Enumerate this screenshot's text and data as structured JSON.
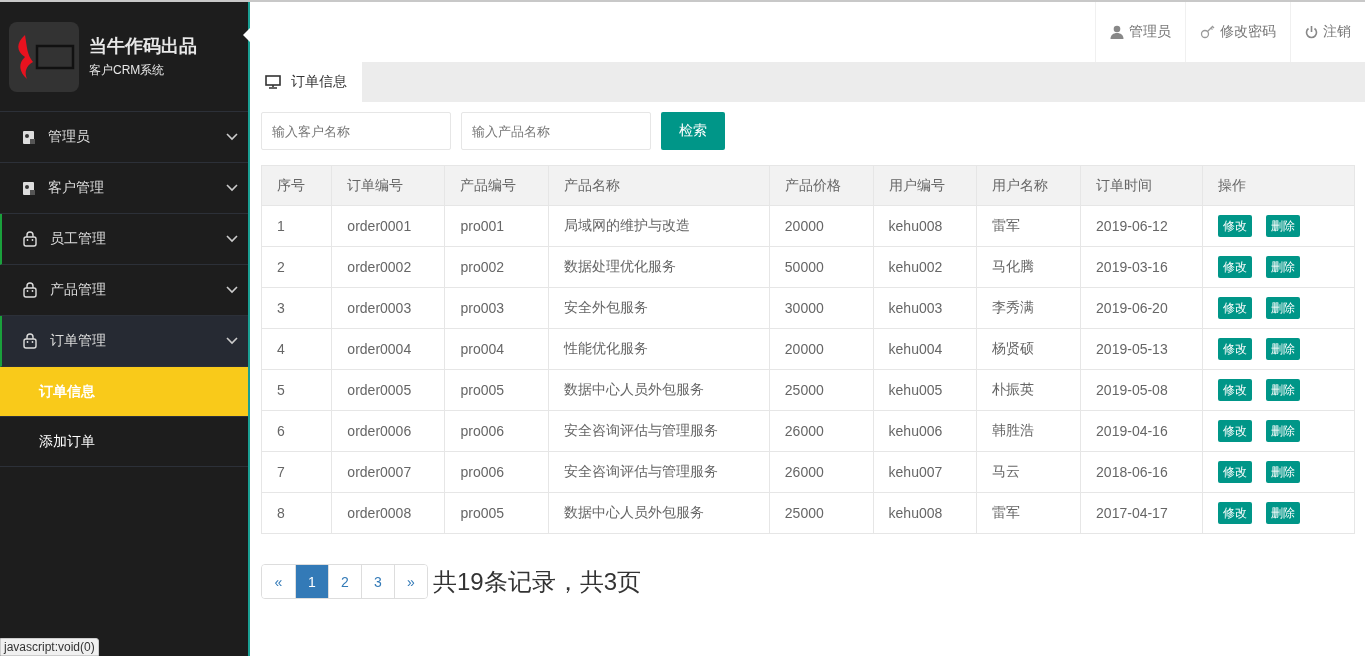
{
  "brand": {
    "title": "当牛作码出品",
    "subtitle": "客户CRM系统"
  },
  "sidebar": {
    "items": [
      {
        "label": "管理员",
        "kind": "badge",
        "expanded": false,
        "marked": false
      },
      {
        "label": "客户管理",
        "kind": "badge",
        "expanded": false,
        "marked": false
      },
      {
        "label": "员工管理",
        "kind": "bag",
        "expanded": false,
        "marked": true
      },
      {
        "label": "产品管理",
        "kind": "bag",
        "expanded": false,
        "marked": false
      },
      {
        "label": "订单管理",
        "kind": "bag",
        "expanded": true,
        "marked": true,
        "children": [
          {
            "label": "订单信息",
            "selected": true
          },
          {
            "label": "添加订单",
            "selected": false
          }
        ]
      }
    ]
  },
  "header": {
    "links": [
      {
        "kind": "user",
        "label": "管理员"
      },
      {
        "kind": "key",
        "label": "修改密码"
      },
      {
        "kind": "power",
        "label": "注销"
      }
    ]
  },
  "tabs": [
    {
      "label": "订单信息",
      "selected": true
    }
  ],
  "search": {
    "fields": [
      {
        "placeholder": "输入客户名称"
      },
      {
        "placeholder": "输入产品名称"
      }
    ],
    "button": "检索"
  },
  "table": {
    "columns": [
      "序号",
      "订单编号",
      "产品编号",
      "产品名称",
      "产品价格",
      "用户编号",
      "用户名称",
      "订单时间",
      "操作"
    ],
    "rows": [
      {
        "cells": [
          "1",
          "order0001",
          "pro001",
          "局域网的维护与改造",
          "20000",
          "kehu008",
          "雷军",
          "2019-06-12"
        ],
        "actions": [
          "修改",
          "删除"
        ]
      },
      {
        "cells": [
          "2",
          "order0002",
          "pro002",
          "数据处理优化服务",
          "50000",
          "kehu002",
          "马化腾",
          "2019-03-16"
        ],
        "actions": [
          "修改",
          "删除"
        ]
      },
      {
        "cells": [
          "3",
          "order0003",
          "pro003",
          "安全外包服务",
          "30000",
          "kehu003",
          "李秀满",
          "2019-06-20"
        ],
        "actions": [
          "修改",
          "删除"
        ]
      },
      {
        "cells": [
          "4",
          "order0004",
          "pro004",
          "性能优化服务",
          "20000",
          "kehu004",
          "杨贤硕",
          "2019-05-13"
        ],
        "actions": [
          "修改",
          "删除"
        ]
      },
      {
        "cells": [
          "5",
          "order0005",
          "pro005",
          "数据中心人员外包服务",
          "25000",
          "kehu005",
          "朴振英",
          "2019-05-08"
        ],
        "actions": [
          "修改",
          "删除"
        ]
      },
      {
        "cells": [
          "6",
          "order0006",
          "pro006",
          "安全咨询评估与管理服务",
          "26000",
          "kehu006",
          "韩胜浩",
          "2019-04-16"
        ],
        "actions": [
          "修改",
          "删除"
        ]
      },
      {
        "cells": [
          "7",
          "order0007",
          "pro006",
          "安全咨询评估与管理服务",
          "26000",
          "kehu007",
          "马云",
          "2018-06-16"
        ],
        "actions": [
          "修改",
          "删除"
        ]
      },
      {
        "cells": [
          "8",
          "order0008",
          "pro005",
          "数据中心人员外包服务",
          "25000",
          "kehu008",
          "雷军",
          "2017-04-17"
        ],
        "actions": [
          "修改",
          "删除"
        ]
      }
    ]
  },
  "pagination": {
    "prev": "«",
    "pages": [
      {
        "label": "1",
        "selected": true
      },
      {
        "label": "2",
        "selected": false
      },
      {
        "label": "3",
        "selected": false
      }
    ],
    "next": "»",
    "summary": "共19条记录，共3页"
  },
  "status_bar": "javascript:void(0)"
}
